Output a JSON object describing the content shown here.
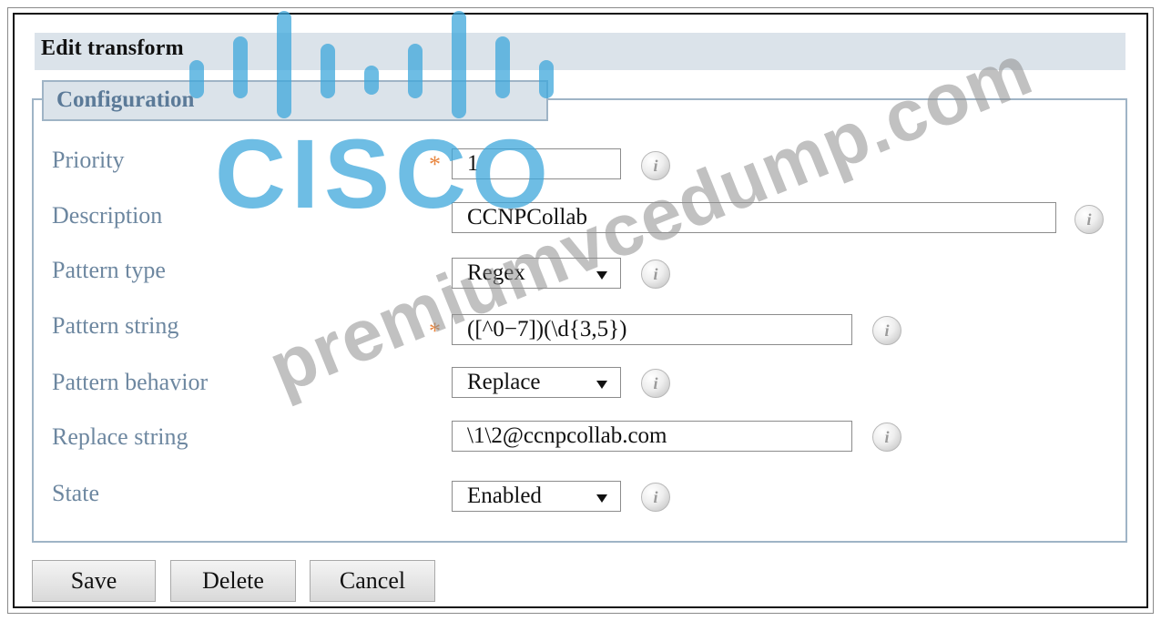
{
  "window": {
    "title": "Edit transform"
  },
  "section": {
    "legend": "Configuration"
  },
  "form": {
    "priority": {
      "label": "Priority",
      "value": "1",
      "required": true
    },
    "description": {
      "label": "Description",
      "value": "CCNPCollab"
    },
    "pattern_type": {
      "label": "Pattern type",
      "value": "Regex"
    },
    "pattern_string": {
      "label": "Pattern string",
      "value": "([^0−7])(\\d{3,5})",
      "required": true
    },
    "pattern_behavior": {
      "label": "Pattern behavior",
      "value": "Replace"
    },
    "replace_string": {
      "label": "Replace string",
      "value": "\\1\\2@ccnpcollab.com"
    },
    "state": {
      "label": "State",
      "value": "Enabled"
    }
  },
  "buttons": {
    "save": "Save",
    "delete": "Delete",
    "cancel": "Cancel"
  },
  "icons": {
    "info": "i",
    "required": "*",
    "dropdown": "chevron-down-icon"
  },
  "watermarks": {
    "logo_text": "CISCO",
    "site_text": "premiumvcedump.com"
  },
  "colors": {
    "label": "#6d87a0",
    "required": "#e8843c",
    "header_bg": "#dbe3ea",
    "border": "#9fb4c6",
    "logo": "#3ea7dc"
  }
}
